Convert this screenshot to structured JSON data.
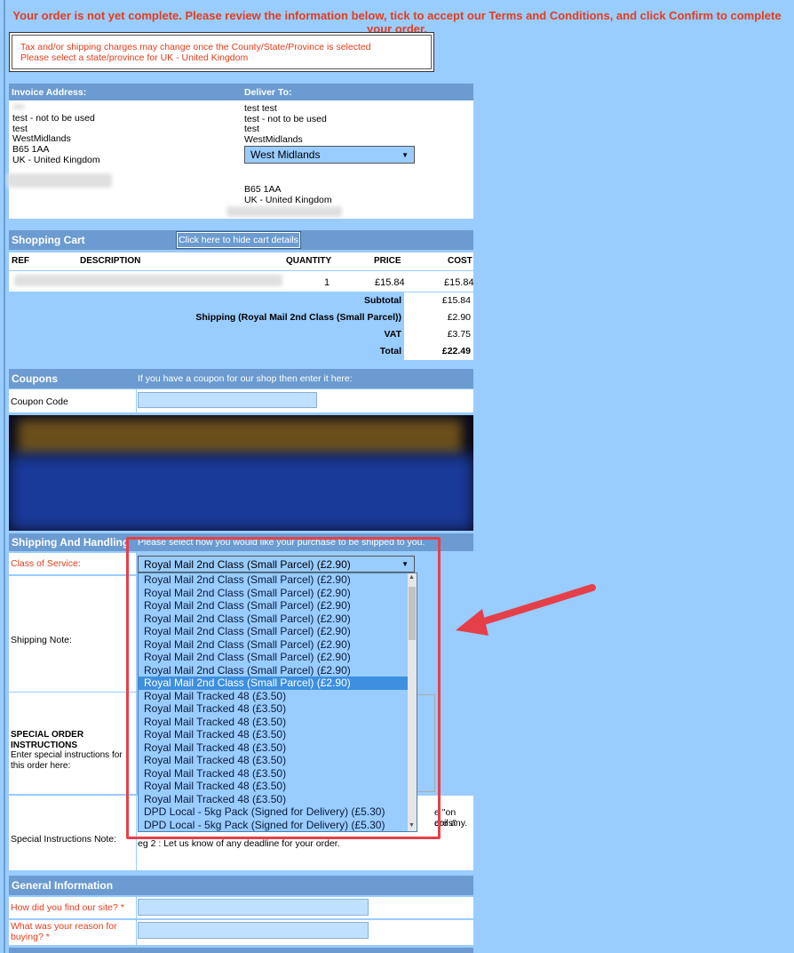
{
  "warning": "Your order is not yet complete. Please review the information below, tick to accept our Terms and Conditions, and click Confirm to complete your order.",
  "notice": {
    "line1": "Tax and/or shipping charges may change once the County/State/Province is selected",
    "line2": "Please select a state/province for UK - United Kingdom"
  },
  "invoice": {
    "header": "Invoice Address:",
    "lines": [
      "test - not to be used",
      "test",
      "WestMidlands",
      "B65 1AA",
      "UK - United Kingdom"
    ]
  },
  "deliver": {
    "header": "Deliver To:",
    "lines": [
      "test test",
      "test - not to be used",
      "test",
      "WestMidlands"
    ],
    "county_select": "West Midlands",
    "postcode": "B65 1AA",
    "country": "UK - United Kingdom"
  },
  "cart": {
    "header": "Shopping Cart",
    "toggle_button": "Click here to hide cart details",
    "columns": [
      "REF",
      "DESCRIPTION",
      "QUANTITY",
      "PRICE",
      "COST"
    ],
    "row": {
      "quantity": "1",
      "price": "£15.84",
      "cost": "£15.84"
    },
    "subtotal_label": "Subtotal",
    "subtotal": "£15.84",
    "shipping_label": "Shipping (Royal Mail 2nd Class (Small Parcel))",
    "shipping": "£2.90",
    "vat_label": "VAT",
    "vat": "£3.75",
    "total_label": "Total",
    "total": "£22.49"
  },
  "coupons": {
    "header": "Coupons",
    "hint": "If you have a coupon for our shop then enter it here:",
    "label": "Coupon Code",
    "value": ""
  },
  "shipping": {
    "header": "Shipping And Handling",
    "hint": "Please select how you would like your purchase to be shipped to you.",
    "class_label": "Class of Service:",
    "selected": "Royal Mail 2nd Class (Small Parcel) (£2.90)",
    "options": [
      "Royal Mail 2nd Class (Small Parcel) (£2.90)",
      "Royal Mail 2nd Class (Small Parcel) (£2.90)",
      "Royal Mail 2nd Class (Small Parcel) (£2.90)",
      "Royal Mail 2nd Class (Small Parcel) (£2.90)",
      "Royal Mail 2nd Class (Small Parcel) (£2.90)",
      "Royal Mail 2nd Class (Small Parcel) (£2.90)",
      "Royal Mail 2nd Class (Small Parcel) (£2.90)",
      "Royal Mail 2nd Class (Small Parcel) (£2.90)",
      "Royal Mail 2nd Class (Small Parcel) (£2.90)",
      "Royal Mail Tracked 48 (£3.50)",
      "Royal Mail Tracked 48 (£3.50)",
      "Royal Mail Tracked 48 (£3.50)",
      "Royal Mail Tracked 48 (£3.50)",
      "Royal Mail Tracked 48 (£3.50)",
      "Royal Mail Tracked 48 (£3.50)",
      "Royal Mail Tracked 48 (£3.50)",
      "Royal Mail Tracked 48 (£3.50)",
      "Royal Mail Tracked 48 (£3.50)",
      "DPD Local - 5kg Pack (Signed for Delivery) (£5.30)",
      "DPD Local - 5kg Pack (Signed for Delivery) (£5.30)"
    ],
    "highlighted_index": 8,
    "note_label": "Shipping Note:",
    "special_title": "SPECIAL ORDER INSTRUCTIONS",
    "special_sub": "Enter special instructions for this order here:",
    "sin_label": "Special Instructions Note:",
    "sin_frag1": "e \"on coils\"",
    "sin_frag2": "are any.",
    "sin_line2": "eg 2 : Let us know of any deadline for your order."
  },
  "general": {
    "header": "General Information",
    "q1": "How did you find our site? *",
    "q2": "What was your reason for buying? *"
  }
}
